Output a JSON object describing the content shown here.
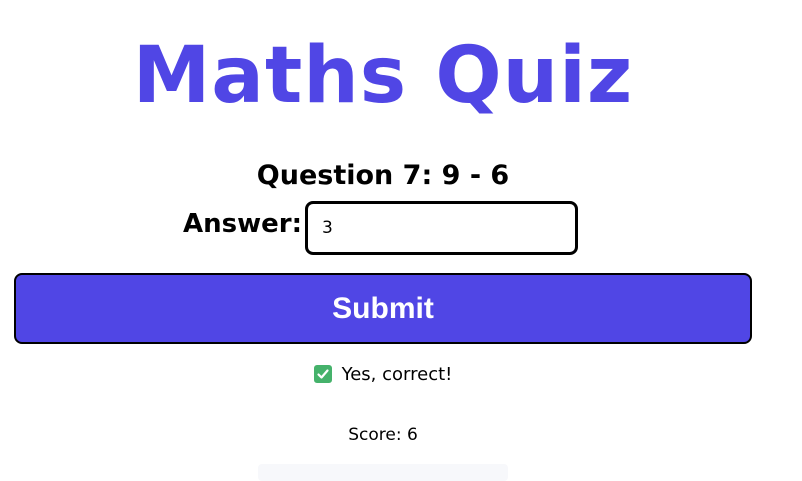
{
  "quiz": {
    "title": "Maths Quiz",
    "question_text": "Question 7: 9 - 6",
    "answer_label": "Answer:",
    "answer_value": "3",
    "submit_label": "Submit",
    "feedback_icon": "check-icon",
    "feedback_text": "Yes, correct!",
    "score_text": "Score: 6"
  },
  "colors": {
    "accent": "#5046e5",
    "success": "#45b26b"
  }
}
